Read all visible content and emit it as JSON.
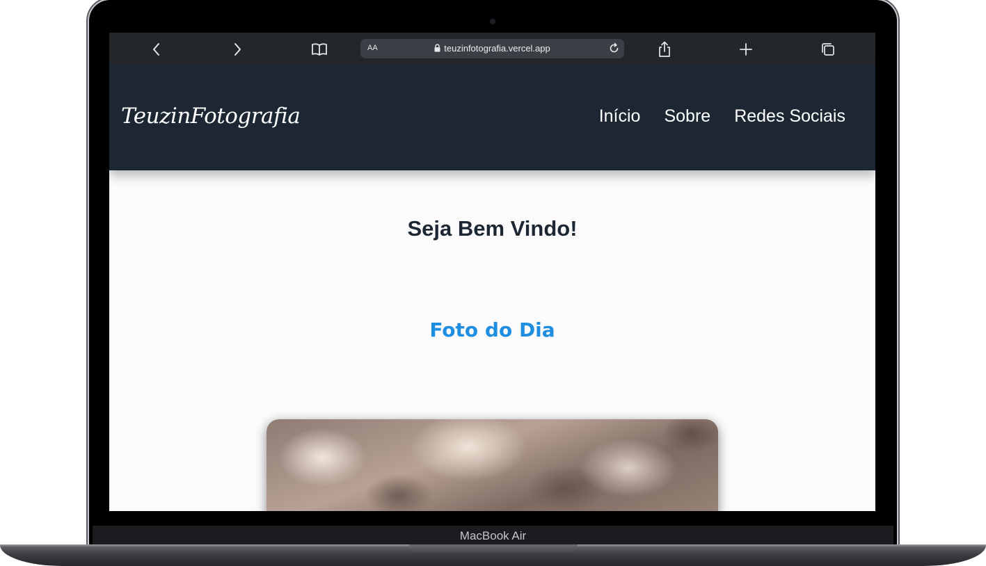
{
  "device": {
    "label": "MacBook Air"
  },
  "browser": {
    "text_size_label": "AA",
    "url": "teuzinfotografia.vercel.app",
    "icons": [
      "back-icon",
      "forward-icon",
      "bookmarks-icon",
      "lock-icon",
      "reload-icon",
      "share-icon",
      "new-tab-icon",
      "tabs-icon"
    ]
  },
  "site": {
    "logo": "TeuzinFotografia",
    "nav": [
      "Início",
      "Sobre",
      "Redes Sociais"
    ],
    "welcome": "Seja Bem Vindo!",
    "photo_section_title": "Foto do Dia"
  },
  "colors": {
    "header_bg": "#1c2733",
    "accent": "#1f8ee0",
    "page_bg": "#fbfbfb"
  }
}
